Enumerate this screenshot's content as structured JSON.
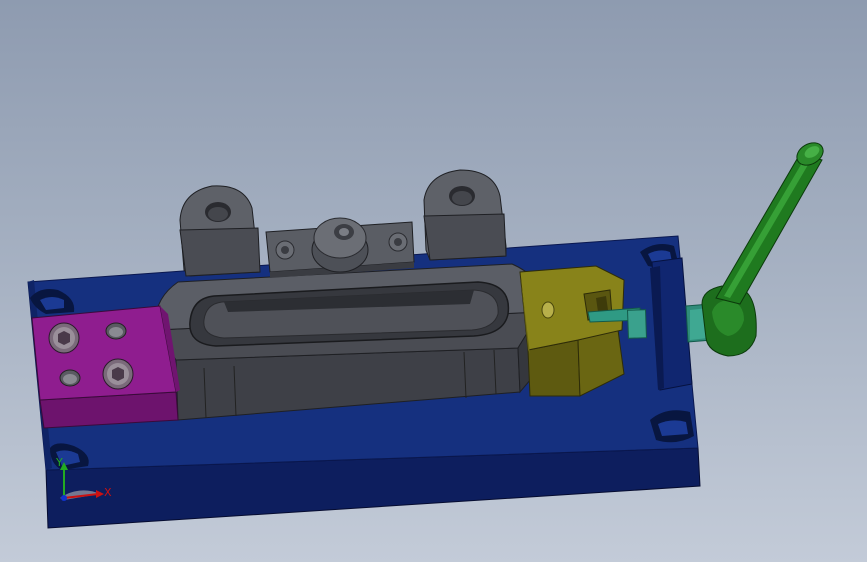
{
  "viewport": {
    "background_top": "#8e9bb0",
    "background_bottom": "#c3cbd8"
  },
  "model": {
    "parts": [
      {
        "name": "base-plate",
        "color": "#13297a"
      },
      {
        "name": "fixture-body",
        "color": "#555860"
      },
      {
        "name": "locating-block",
        "color": "#8a1a8a"
      },
      {
        "name": "clamp-jaw",
        "color": "#7e7a15"
      },
      {
        "name": "screw-shaft",
        "color": "#2f9a84"
      },
      {
        "name": "handle-lever",
        "color": "#1b6a1b"
      }
    ]
  },
  "triad": {
    "x_label": "X",
    "y_label": "Y",
    "x_color": "#cc1111",
    "y_color": "#22aa22",
    "z_color": "#1133cc"
  }
}
